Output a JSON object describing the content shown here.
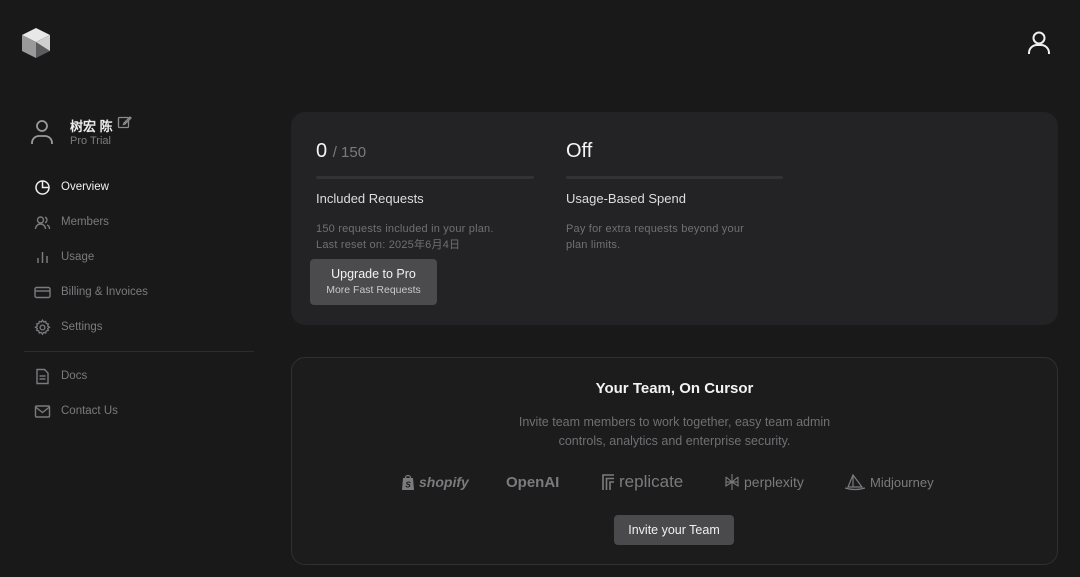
{
  "header": {
    "user_icon": "user-icon",
    "logo": "cursor-logo"
  },
  "profile": {
    "name": "树宏 陈",
    "plan": "Pro Trial"
  },
  "sidebar": {
    "items": [
      {
        "label": "Overview",
        "icon": "pie-chart-icon",
        "active": true
      },
      {
        "label": "Members",
        "icon": "users-icon"
      },
      {
        "label": "Usage",
        "icon": "bar-chart-icon"
      },
      {
        "label": "Billing & Invoices",
        "icon": "credit-card-icon"
      },
      {
        "label": "Settings",
        "icon": "gear-icon"
      }
    ],
    "secondary": [
      {
        "label": "Docs",
        "icon": "document-icon"
      },
      {
        "label": "Contact Us",
        "icon": "mail-icon"
      }
    ]
  },
  "requests": {
    "used": "0",
    "total": "/ 150",
    "title": "Included Requests",
    "desc_line1": "150 requests included in your plan.",
    "desc_line2": "Last reset on: 2025年6月4日",
    "progress": 0
  },
  "usage_spend": {
    "status": "Off",
    "title": "Usage-Based Spend",
    "desc_line1": "Pay for extra requests beyond your",
    "desc_line2": "plan limits."
  },
  "upgrade": {
    "label": "Upgrade to Pro",
    "sub": "More Fast Requests"
  },
  "team": {
    "title": "Your Team, On Cursor",
    "desc_line1": "Invite team members to work together, easy team admin",
    "desc_line2": "controls, analytics and enterprise security.",
    "brands": [
      "shopify",
      "OpenAI",
      "replicate",
      "perplexity",
      "Midjourney"
    ],
    "invite_label": "Invite your Team"
  },
  "colors": {
    "background": "#19191a",
    "card": "#232325",
    "button": "#4b4b4e"
  }
}
